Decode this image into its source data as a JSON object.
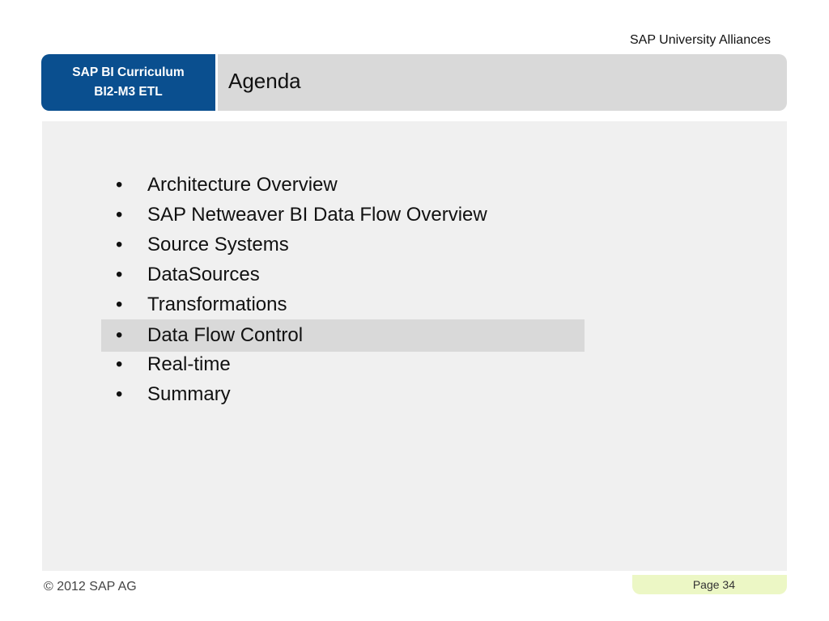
{
  "header": {
    "organization": "SAP University Alliances",
    "curriculum_line1": "SAP BI Curriculum",
    "curriculum_line2": "BI2-M3 ETL",
    "title": "Agenda"
  },
  "agenda": {
    "bullet": "•",
    "current_index": 5,
    "items": [
      {
        "label": "Architecture Overview"
      },
      {
        "label": "SAP Netweaver BI Data Flow Overview"
      },
      {
        "label": "Source Systems"
      },
      {
        "label": "DataSources"
      },
      {
        "label": "Transformations"
      },
      {
        "label": "Data Flow Control"
      },
      {
        "label": "Real-time"
      },
      {
        "label": "Summary"
      }
    ]
  },
  "footer": {
    "copyright": "© 2012 SAP AG",
    "page_label": "Page 34"
  },
  "colors": {
    "curriculum_box": "#0a4f8f",
    "header_bar": "#d9d9d9",
    "content_panel": "#f0f0f0",
    "current_item": "#d9d9d9",
    "page_tab": "#ecf7c5"
  }
}
